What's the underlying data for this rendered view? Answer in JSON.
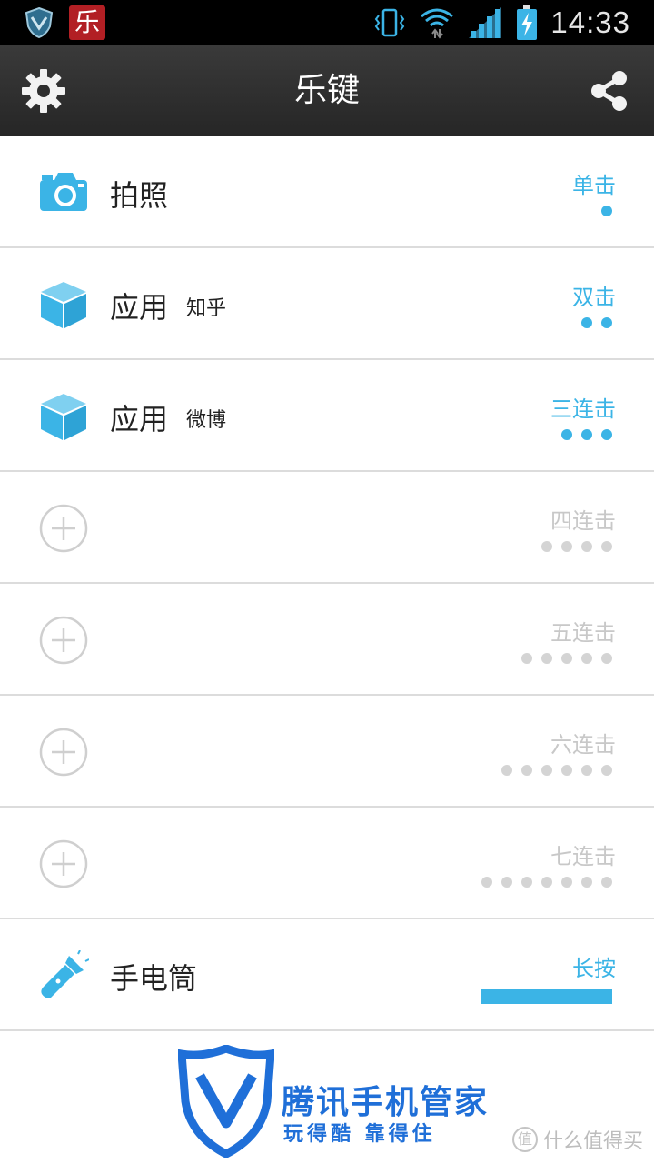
{
  "status_bar": {
    "app_badge": "乐",
    "time": "14:33"
  },
  "header": {
    "title": "乐键"
  },
  "items": [
    {
      "icon": "camera-icon",
      "label": "拍照",
      "sub": "",
      "gesture": "单击",
      "taps": 1,
      "active": true
    },
    {
      "icon": "cube-icon",
      "label": "应用",
      "sub": "知乎",
      "gesture": "双击",
      "taps": 2,
      "active": true
    },
    {
      "icon": "cube-icon",
      "label": "应用",
      "sub": "微博",
      "gesture": "三连击",
      "taps": 3,
      "active": true
    },
    {
      "icon": "add-circle-icon",
      "label": "",
      "sub": "",
      "gesture": "四连击",
      "taps": 4,
      "active": false
    },
    {
      "icon": "add-circle-icon",
      "label": "",
      "sub": "",
      "gesture": "五连击",
      "taps": 5,
      "active": false
    },
    {
      "icon": "add-circle-icon",
      "label": "",
      "sub": "",
      "gesture": "六连击",
      "taps": 6,
      "active": false
    },
    {
      "icon": "add-circle-icon",
      "label": "",
      "sub": "",
      "gesture": "七连击",
      "taps": 7,
      "active": false
    },
    {
      "icon": "flashlight-icon",
      "label": "手电筒",
      "sub": "",
      "gesture": "长按",
      "taps": 0,
      "active": true
    }
  ],
  "footer": {
    "brand": "腾讯手机管家",
    "slogan": "玩得酷  靠得住",
    "watermark": "什么值得买"
  },
  "colors": {
    "accent": "#3bb4e6",
    "inactive": "#c8c8c8",
    "brand": "#1f6fd8"
  }
}
